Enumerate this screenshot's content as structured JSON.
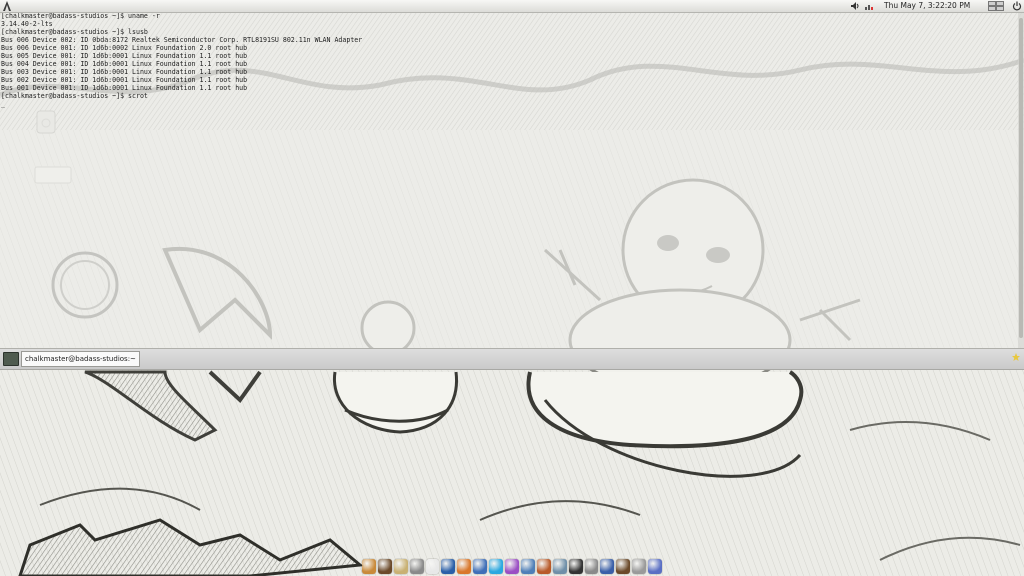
{
  "top_panel": {
    "clock": "Thu May  7,  3:22:20 PM",
    "icons": [
      "distro-logo-icon",
      "volume-icon",
      "network-icon",
      "workspace-switcher-icon",
      "power-icon"
    ]
  },
  "terminal": {
    "lines": [
      "[chalkmaster@badass-studios ~]$ uname -r",
      "3.14.40-2-lts",
      "[chalkmaster@badass-studios ~]$ lsusb",
      "Bus 006 Device 002: ID 0bda:8172 Realtek Semiconductor Corp. RTL8191SU 802.11n WLAN Adapter",
      "Bus 006 Device 001: ID 1d6b:0002 Linux Foundation 2.0 root hub",
      "Bus 005 Device 001: ID 1d6b:0001 Linux Foundation 1.1 root hub",
      "Bus 004 Device 001: ID 1d6b:0001 Linux Foundation 1.1 root hub",
      "Bus 003 Device 001: ID 1d6b:0001 Linux Foundation 1.1 root hub",
      "Bus 002 Device 001: ID 1d6b:0001 Linux Foundation 1.1 root hub",
      "Bus 001 Device 001: ID 1d6b:0001 Linux Foundation 1.1 root hub",
      "[chalkmaster@badass-studios ~]$ scrot",
      "_"
    ],
    "tab_label": "chalkmaster@badass-studios:~"
  },
  "dock": {
    "items": [
      {
        "name": "text-editor-icon",
        "color": "#c98a3a"
      },
      {
        "name": "gimp-icon",
        "color": "#6b4a2a"
      },
      {
        "name": "notes-icon",
        "color": "#c9b173"
      },
      {
        "name": "inkscape-icon",
        "color": "#8a8a8a"
      },
      {
        "name": "vlc-icon",
        "color": "#e8e8e8"
      },
      {
        "name": "thunderbird-icon",
        "color": "#2a5fa8"
      },
      {
        "name": "firefox-icon",
        "color": "#d9772a"
      },
      {
        "name": "app-store-icon",
        "color": "#3f6fb8"
      },
      {
        "name": "skype-icon",
        "color": "#2aa8e0"
      },
      {
        "name": "itunes-icon",
        "color": "#9b4fc4"
      },
      {
        "name": "photos-icon",
        "color": "#4f7fb8"
      },
      {
        "name": "mixer-icon",
        "color": "#b85a2a"
      },
      {
        "name": "steam-icon",
        "color": "#6f8fa8"
      },
      {
        "name": "disc-icon",
        "color": "#333333"
      },
      {
        "name": "search-icon",
        "color": "#8a8a8a"
      },
      {
        "name": "music-icon",
        "color": "#3a5fa8"
      },
      {
        "name": "terminal-icon",
        "color": "#6b4a2a"
      },
      {
        "name": "printer-icon",
        "color": "#9a9a9a"
      },
      {
        "name": "game-icon",
        "color": "#5a6fc4"
      }
    ]
  }
}
